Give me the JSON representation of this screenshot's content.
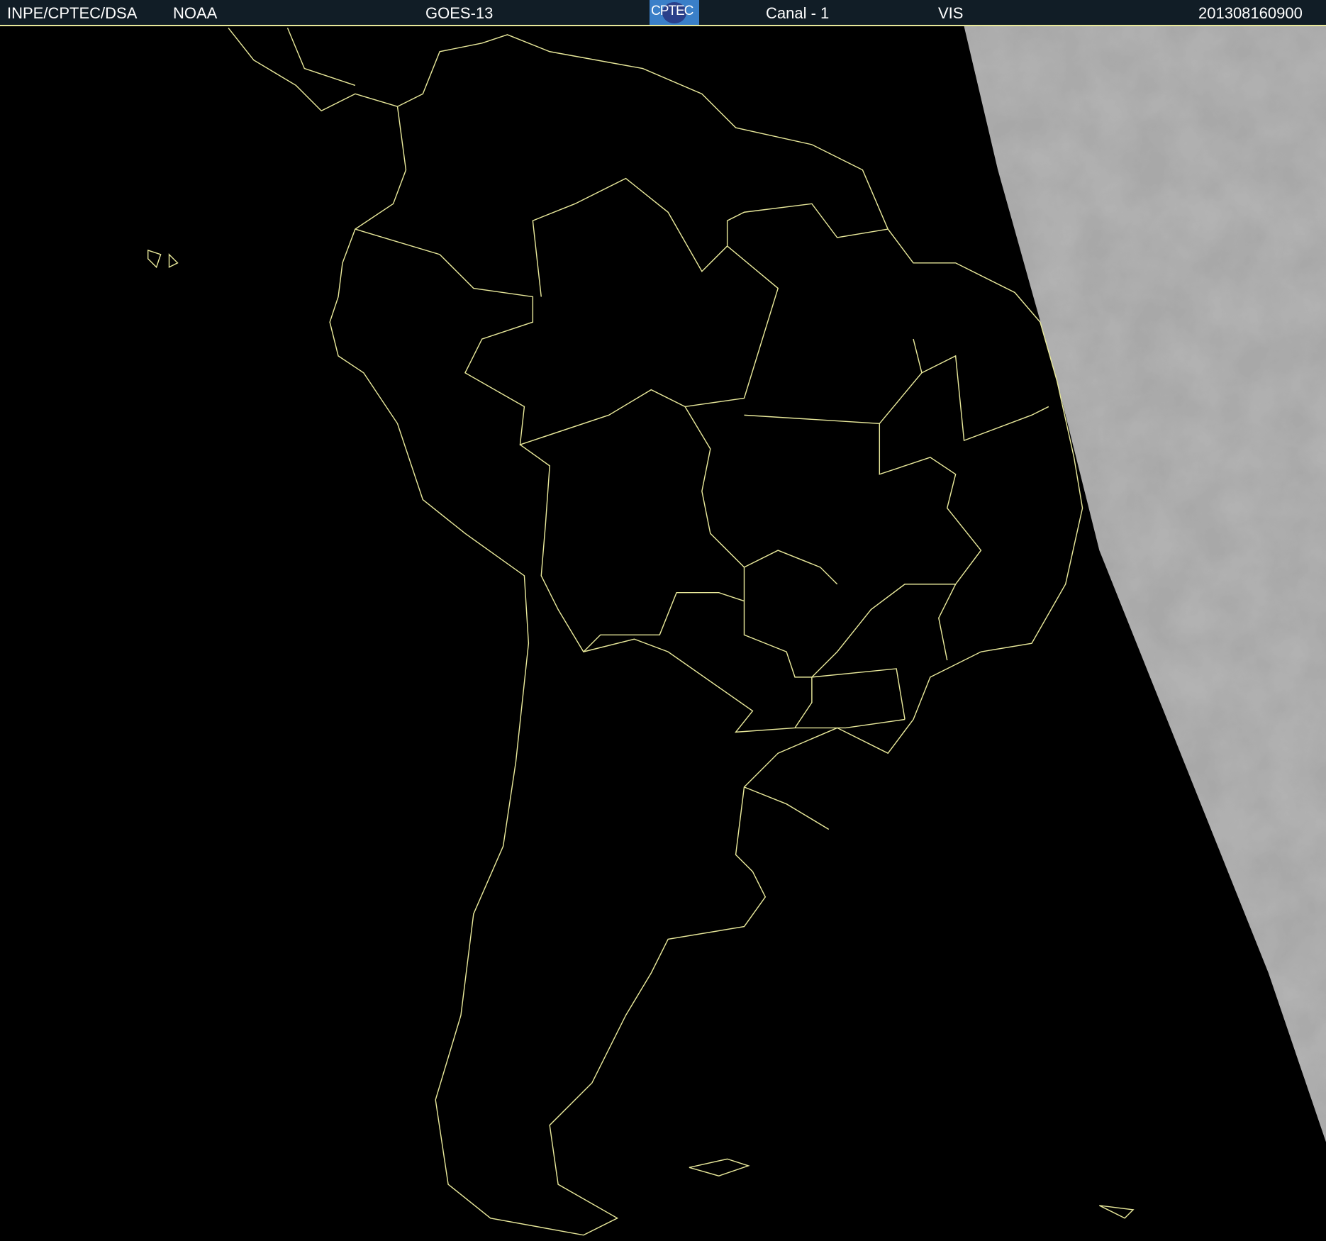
{
  "header": {
    "institution": "INPE/CPTEC/DSA",
    "agency": "NOAA",
    "satellite": "GOES-13",
    "logo_text": "CPTEC",
    "channel": "Canal - 1",
    "band": "VIS",
    "timestamp": "201308160900"
  },
  "colors": {
    "header_bg": "#111d26",
    "outline": "#e8e89a",
    "clouds": "#b8b8b8"
  }
}
